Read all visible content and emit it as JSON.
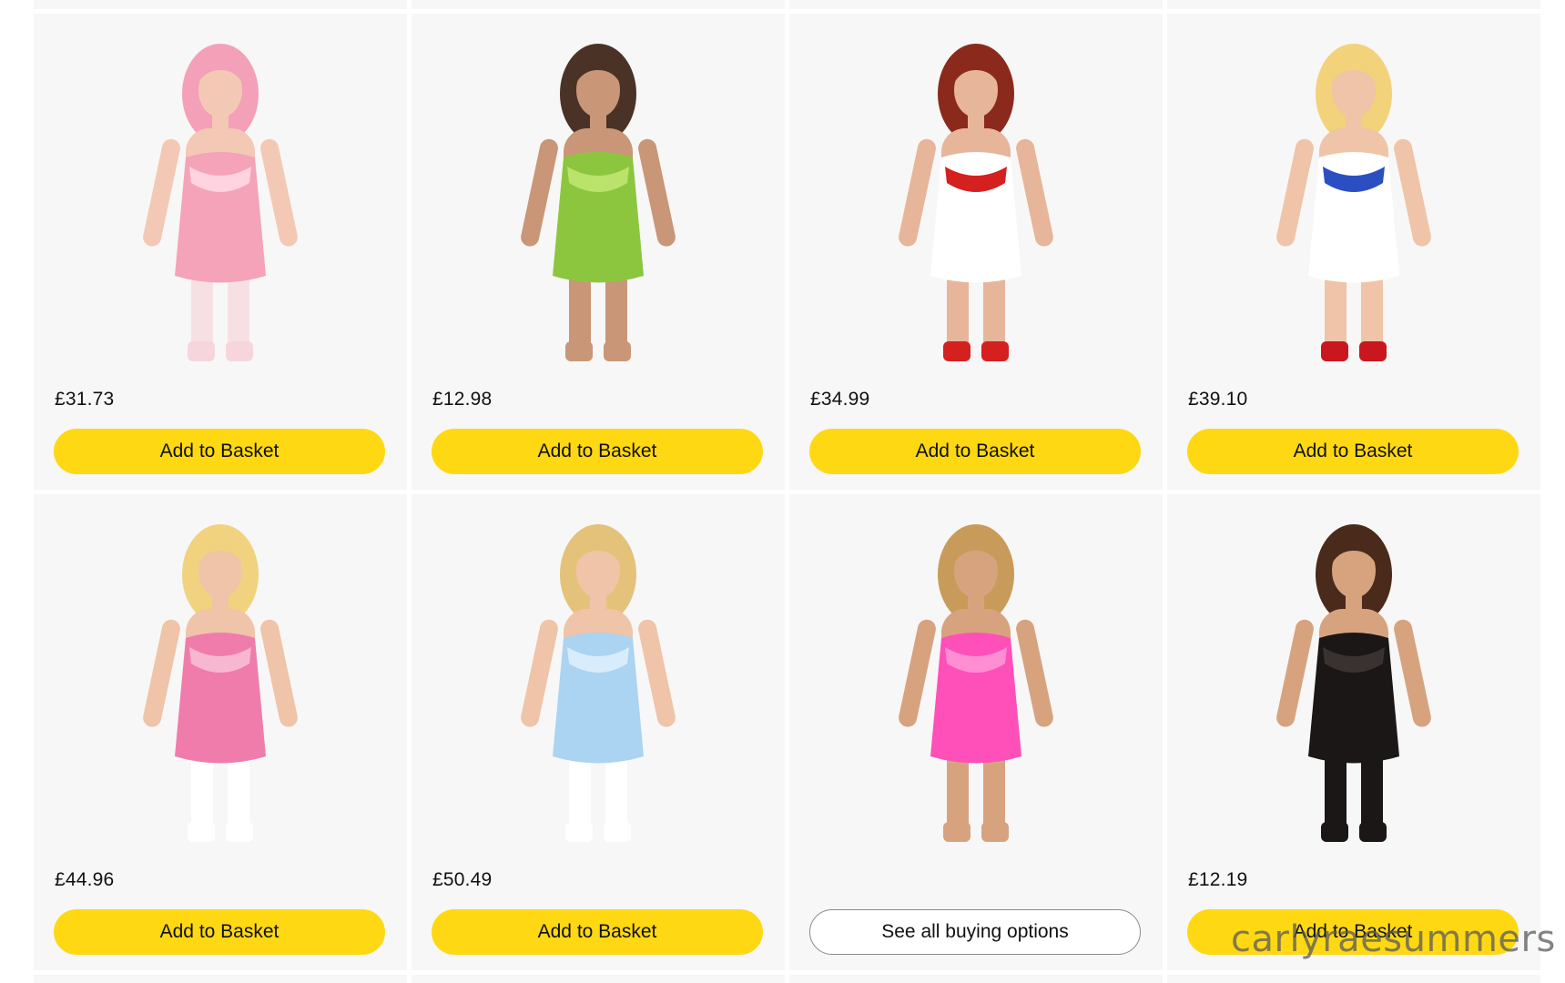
{
  "colors": {
    "card_background": "#f7f7f7",
    "button_yellow": "#ffd814",
    "button_outline_border": "#888c8c",
    "text": "#0f1111"
  },
  "products": [
    {
      "price": "£31.73",
      "button_label": "Add to Basket",
      "button_style": "yellow",
      "image": {
        "skin": "#f3c9b5",
        "hair": "#f4a0b8",
        "outfit": "#f4a3b8",
        "accent": "#ffd3df",
        "legs": "#f7e0e3",
        "shoes": "#f6d6dc"
      }
    },
    {
      "price": "£12.98",
      "button_label": "Add to Basket",
      "button_style": "yellow",
      "image": {
        "skin": "#c99677",
        "hair": "#4a3326",
        "outfit": "#8cc63f",
        "accent": "#b9e36a",
        "legs": "#c99677",
        "shoes": "#c99677"
      }
    },
    {
      "price": "£34.99",
      "button_label": "Add to Basket",
      "button_style": "yellow",
      "image": {
        "skin": "#e7b59a",
        "hair": "#8b2a1c",
        "outfit": "#ffffff",
        "accent": "#d4201f",
        "legs": "#e7b59a",
        "shoes": "#d4201f"
      }
    },
    {
      "price": "£39.10",
      "button_label": "Add to Basket",
      "button_style": "yellow",
      "image": {
        "skin": "#efc4a8",
        "hair": "#f2d27a",
        "outfit": "#ffffff",
        "accent": "#2b4fc2",
        "legs": "#efc4a8",
        "shoes": "#c8171f"
      }
    },
    {
      "price": "£44.96",
      "button_label": "Add to Basket",
      "button_style": "yellow",
      "image": {
        "skin": "#efc4a8",
        "hair": "#f1d27f",
        "outfit": "#f07cab",
        "accent": "#f8b7d0",
        "legs": "#ffffff",
        "shoes": "#ffffff"
      }
    },
    {
      "price": "£50.49",
      "button_label": "Add to Basket",
      "button_style": "yellow",
      "image": {
        "skin": "#efc4a8",
        "hair": "#e4c27a",
        "outfit": "#aad4f2",
        "accent": "#d9ecfb",
        "legs": "#ffffff",
        "shoes": "#ffffff"
      }
    },
    {
      "price": "",
      "button_label": "See all buying options",
      "button_style": "outline",
      "image": {
        "skin": "#d7a37f",
        "hair": "#c99b5a",
        "outfit": "#ff4fb8",
        "accent": "#ff8fd2",
        "legs": "#d7a37f",
        "shoes": "#d7a37f"
      }
    },
    {
      "price": "£12.19",
      "button_label": "Add to Basket",
      "button_style": "yellow",
      "image": {
        "skin": "#d7a37f",
        "hair": "#4a2a1a",
        "outfit": "#1b1716",
        "accent": "#3a3230",
        "legs": "#1b1716",
        "shoes": "#1b1716"
      }
    }
  ],
  "watermark": "carlyraesummers"
}
